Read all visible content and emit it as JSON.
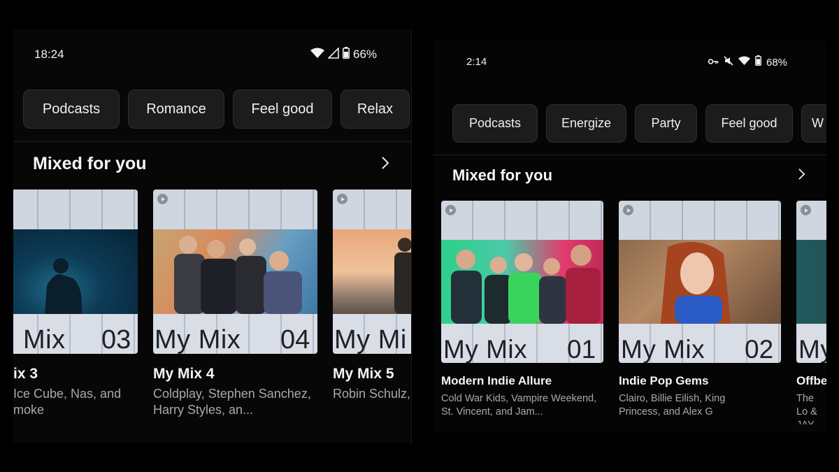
{
  "left_screen": {
    "status": {
      "time": "18:24",
      "battery": "66%"
    },
    "chips": [
      "Podcasts",
      "Romance",
      "Feel good",
      "Relax"
    ],
    "section_title": "Mixed for you",
    "cards": [
      {
        "mix_word": "Mix",
        "mix_num": "03",
        "title": "ix 3",
        "subtitle": "Ice Cube, Nas, and moke"
      },
      {
        "mix_word": "My Mix",
        "mix_num": "04",
        "title": "My Mix 4",
        "subtitle": "Coldplay, Stephen Sanchez, Harry Styles, an..."
      },
      {
        "mix_word": "My Mi",
        "mix_num": "",
        "title": "My Mix 5",
        "subtitle": "Robin Schulz, and French M"
      }
    ]
  },
  "right_screen": {
    "status": {
      "time": "2:14",
      "battery": "68%"
    },
    "chips": [
      "Podcasts",
      "Energize",
      "Party",
      "Feel good",
      "W"
    ],
    "section_title": "Mixed for you",
    "cards": [
      {
        "mix_word": "My Mix",
        "mix_num": "01",
        "title": "Modern Indie Allure",
        "subtitle": "Cold War Kids, Vampire Weekend, St. Vincent, and Jam..."
      },
      {
        "mix_word": "My Mix",
        "mix_num": "02",
        "title": "Indie Pop Gems",
        "subtitle": "Clairo, Billie Eilish, King Princess, and Alex G"
      },
      {
        "mix_word": "My",
        "mix_num": "",
        "title": "Offbe",
        "subtitle": "The Lo & JAY-"
      }
    ]
  },
  "icons": {
    "wifi": "wifi-icon",
    "signal": "signal-icon",
    "battery": "battery-icon",
    "key": "vpn-key-icon",
    "mute": "mute-icon",
    "chevron": "chevron-right-icon",
    "play": "play-badge-icon"
  }
}
